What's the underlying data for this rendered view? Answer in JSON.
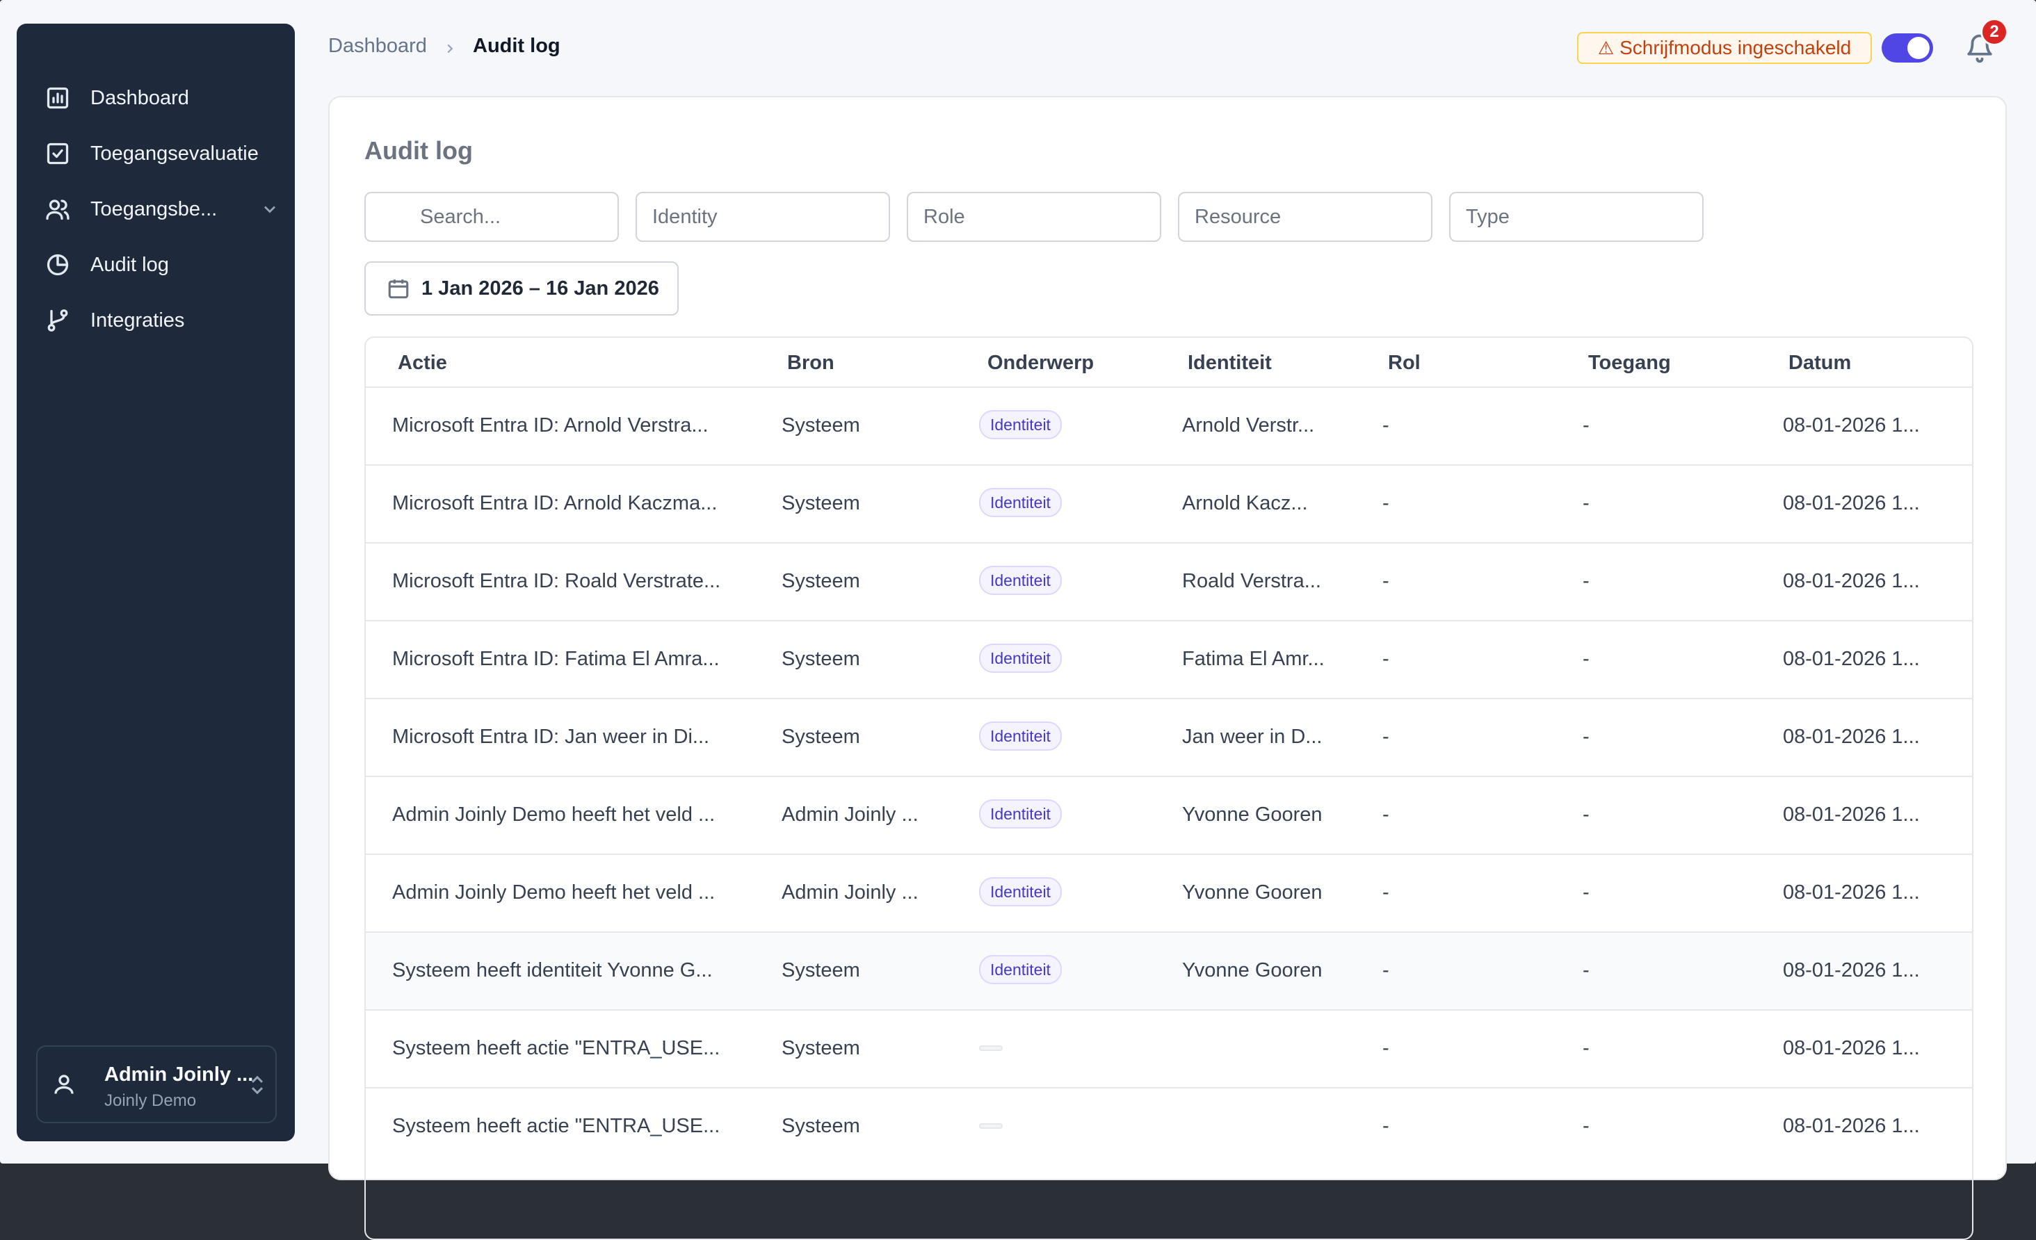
{
  "sidebar": {
    "items": [
      {
        "label": "Dashboard",
        "icon": "chart-icon"
      },
      {
        "label": "Toegangsevaluatie",
        "icon": "check-square-icon"
      },
      {
        "label": "Toegangsbe...",
        "icon": "users-icon"
      },
      {
        "label": "Audit log",
        "icon": "pie-chart-icon"
      },
      {
        "label": "Integraties",
        "icon": "git-branch-icon"
      }
    ],
    "user": {
      "name": "Admin Joinly ...",
      "org": "Joinly Demo"
    }
  },
  "breadcrumb": {
    "home": "Dashboard",
    "current": "Audit log"
  },
  "header": {
    "write_mode": "Schrijfmodus ingeschakeld",
    "write_mode_enabled": true,
    "notification_count": "2"
  },
  "card": {
    "title": "Audit log",
    "filters": {
      "search_placeholder": "Search...",
      "identity_placeholder": "Identity",
      "role_placeholder": "Role",
      "resource_placeholder": "Resource",
      "type_placeholder": "Type"
    },
    "date_range": "1 Jan 2026 – 16 Jan 2026"
  },
  "table": {
    "columns": [
      "Actie",
      "Bron",
      "Onderwerp",
      "Identiteit",
      "Rol",
      "Toegang",
      "Datum"
    ],
    "rows": [
      {
        "actie": "Microsoft Entra ID: Arnold Verstra...",
        "bron": "Systeem",
        "onderwerp": "Identiteit",
        "identiteit": "Arnold Verstr...",
        "rol": "-",
        "toegang": "-",
        "datum": "08-01-2026 1..."
      },
      {
        "actie": "Microsoft Entra ID: Arnold Kaczma...",
        "bron": "Systeem",
        "onderwerp": "Identiteit",
        "identiteit": "Arnold Kacz...",
        "rol": "-",
        "toegang": "-",
        "datum": "08-01-2026 1..."
      },
      {
        "actie": "Microsoft Entra ID: Roald Verstrate...",
        "bron": "Systeem",
        "onderwerp": "Identiteit",
        "identiteit": "Roald Verstra...",
        "rol": "-",
        "toegang": "-",
        "datum": "08-01-2026 1..."
      },
      {
        "actie": "Microsoft Entra ID: Fatima El Amra...",
        "bron": "Systeem",
        "onderwerp": "Identiteit",
        "identiteit": "Fatima El Amr...",
        "rol": "-",
        "toegang": "-",
        "datum": "08-01-2026 1..."
      },
      {
        "actie": "Microsoft Entra ID: Jan weer in Di...",
        "bron": "Systeem",
        "onderwerp": "Identiteit",
        "identiteit": "Jan weer in D...",
        "rol": "-",
        "toegang": "-",
        "datum": "08-01-2026 1..."
      },
      {
        "actie": "Admin Joinly Demo heeft het veld ...",
        "bron": "Admin Joinly ...",
        "onderwerp": "Identiteit",
        "identiteit": "Yvonne Gooren",
        "rol": "-",
        "toegang": "-",
        "datum": "08-01-2026 1..."
      },
      {
        "actie": "Admin Joinly Demo heeft het veld ...",
        "bron": "Admin Joinly ...",
        "onderwerp": "Identiteit",
        "identiteit": "Yvonne Gooren",
        "rol": "-",
        "toegang": "-",
        "datum": "08-01-2026 1..."
      },
      {
        "actie": "Systeem heeft identiteit Yvonne G...",
        "bron": "Systeem",
        "onderwerp": "Identiteit",
        "identiteit": "Yvonne Gooren",
        "rol": "-",
        "toegang": "-",
        "datum": "08-01-2026 1...",
        "highlighted": true
      },
      {
        "actie": "Systeem heeft actie \"ENTRA_USE...",
        "bron": "Systeem",
        "onderwerp": "",
        "identiteit": "",
        "rol": "-",
        "toegang": "-",
        "datum": "08-01-2026 1..."
      },
      {
        "actie": "Systeem heeft actie \"ENTRA_USE...",
        "bron": "Systeem",
        "onderwerp": "",
        "identiteit": "",
        "rol": "-",
        "toegang": "-",
        "datum": "08-01-2026 1..."
      }
    ]
  },
  "colors": {
    "sidebar_bg": "#1e293b",
    "accent": "#4f46e5",
    "warning": "#c2410c",
    "badge": "#dc2626",
    "tag": "#4338ca"
  }
}
